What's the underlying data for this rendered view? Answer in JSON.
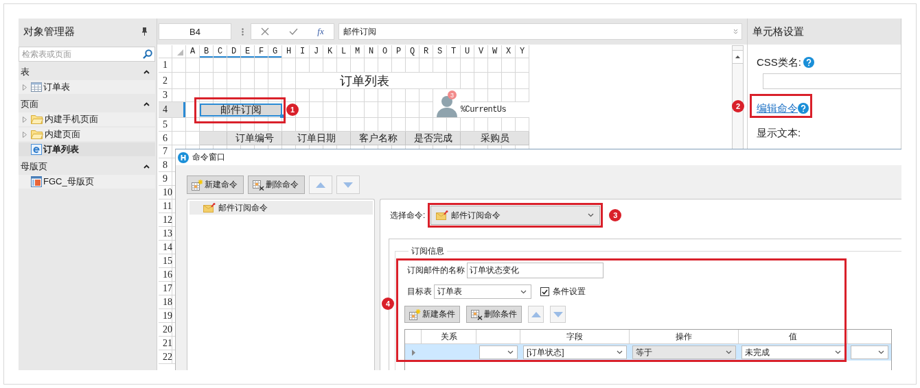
{
  "object_manager": {
    "title": "对象管理器",
    "search": {
      "placeholder": "检索表或页面"
    },
    "sections": [
      {
        "title": "表",
        "expanded": true,
        "items": [
          {
            "label": "订单表",
            "kind": "table",
            "expandable": true,
            "selected": false
          }
        ]
      },
      {
        "title": "页面",
        "expanded": true,
        "items": [
          {
            "label": "内建手机页面",
            "kind": "folder",
            "expandable": true,
            "selected": false
          },
          {
            "label": "内建页面",
            "kind": "folder",
            "expandable": true,
            "selected": false
          },
          {
            "label": "订单列表",
            "kind": "page",
            "expandable": false,
            "selected": true
          }
        ]
      },
      {
        "title": "母版页",
        "expanded": true,
        "items": [
          {
            "label": "FGC_母版页",
            "kind": "layout",
            "expandable": false,
            "selected": false
          }
        ]
      }
    ]
  },
  "formula_bar": {
    "cell_ref": "B4",
    "function_button": "fx",
    "value": "邮件订阅"
  },
  "sheet": {
    "columns": [
      {
        "label": "A",
        "selected": false
      },
      {
        "label": "B",
        "selected": true
      },
      {
        "label": "C",
        "selected": true
      },
      {
        "label": "D",
        "selected": true
      },
      {
        "label": "E",
        "selected": true
      },
      {
        "label": "F",
        "selected": true
      },
      {
        "label": "G",
        "selected": true
      },
      {
        "label": "H",
        "selected": false
      },
      {
        "label": "I",
        "selected": false
      },
      {
        "label": "J",
        "selected": false
      },
      {
        "label": "K",
        "selected": false
      },
      {
        "label": "L",
        "selected": false
      },
      {
        "label": "M",
        "selected": false
      },
      {
        "label": "N",
        "selected": false
      },
      {
        "label": "O",
        "selected": false
      },
      {
        "label": "P",
        "selected": false
      },
      {
        "label": "Q",
        "selected": false
      },
      {
        "label": "R",
        "selected": false
      },
      {
        "label": "S",
        "selected": false
      },
      {
        "label": "T",
        "selected": false
      },
      {
        "label": "U",
        "selected": false
      },
      {
        "label": "V",
        "selected": false
      },
      {
        "label": "W",
        "selected": false
      },
      {
        "label": "X",
        "selected": false
      },
      {
        "label": "Y",
        "selected": false
      }
    ],
    "rows": [
      {
        "label": "1",
        "selected": false
      },
      {
        "label": "2",
        "selected": false
      },
      {
        "label": "3",
        "selected": false
      },
      {
        "label": "4",
        "selected": true
      },
      {
        "label": "5",
        "selected": false
      },
      {
        "label": "6",
        "selected": false
      },
      {
        "label": "7",
        "selected": false
      },
      {
        "label": "8",
        "selected": false
      },
      {
        "label": "9",
        "selected": false
      },
      {
        "label": "10",
        "selected": false
      },
      {
        "label": "11",
        "selected": false
      },
      {
        "label": "12",
        "selected": false
      },
      {
        "label": "13",
        "selected": false
      },
      {
        "label": "14",
        "selected": false
      },
      {
        "label": "15",
        "selected": false
      },
      {
        "label": "16",
        "selected": false
      },
      {
        "label": "17",
        "selected": false
      },
      {
        "label": "18",
        "selected": false
      },
      {
        "label": "19",
        "selected": false
      },
      {
        "label": "20",
        "selected": false
      },
      {
        "label": "21",
        "selected": false
      },
      {
        "label": "22",
        "selected": false
      }
    ],
    "title": "订单列表",
    "button": "邮件订阅",
    "user": {
      "badge": "3",
      "text": "%CurrentUs"
    },
    "header_cells": [
      "订单编号",
      "订单日期",
      "客户名称",
      "是否完成",
      "采购员"
    ]
  },
  "cell_settings": {
    "title": "单元格设置",
    "css_class_label": "CSS类名:",
    "edit_command_link": "编辑命令",
    "display_text_label": "显示文本:"
  },
  "command_window": {
    "title": "命令窗口",
    "buttons": [
      "新建命令",
      "删除命令"
    ],
    "commands": [
      {
        "label": "邮件订阅命令",
        "selected": true
      }
    ],
    "select_label": "选择命令:",
    "selected_command": "邮件订阅命令",
    "group_title": "订阅信息",
    "name_label": "订阅邮件的名称",
    "name_value": "订单状态变化",
    "target_label": "目标表",
    "target_value": "订单表",
    "condition_checkbox": {
      "label": "条件设置",
      "checked": true
    },
    "condition_buttons": [
      "新建条件",
      "删除条件"
    ],
    "condition_table": {
      "columns": [
        "关系",
        "字段",
        "操作",
        "值"
      ],
      "rows": [
        {
          "selected": true,
          "cells": [
            {
              "kind": "combo"
            },
            {
              "kind": "combo",
              "value": "[订单状态]"
            },
            {
              "kind": "dropdown",
              "value": "等于"
            },
            {
              "kind": "combo",
              "value": "未完成"
            },
            {
              "kind": "combo"
            }
          ]
        }
      ]
    }
  },
  "callouts": [
    {
      "number": "1"
    },
    {
      "number": "2"
    },
    {
      "number": "3"
    },
    {
      "number": "4"
    }
  ]
}
